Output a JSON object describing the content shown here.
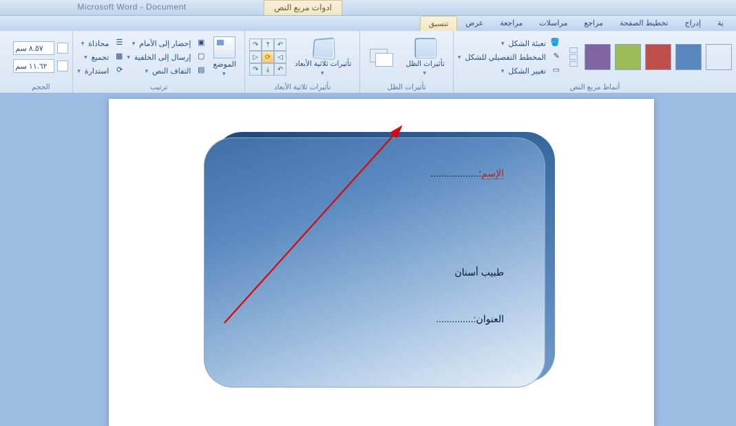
{
  "title": {
    "contextual_tab": "ادوات مربع النص",
    "app": "Microsoft Word - Document"
  },
  "tabs": {
    "t0": "ية",
    "t1": "إدراج",
    "t2": "تخطيط الصفحة",
    "t3": "مراجع",
    "t4": "مراسلات",
    "t5": "مراجعة",
    "t6": "عرض",
    "t7": "تنسيق"
  },
  "styles_group": {
    "label": "أنماط مربع النص",
    "fill": "تعبئة الشكل",
    "outline": "المخطط التفصيلي للشكل",
    "change": "تغيير الشكل",
    "colors": {
      "c0": "#000",
      "c1": "#5b87bf",
      "c2": "#be4f4a",
      "c3": "#9cbb59",
      "c4": "#8064a2"
    }
  },
  "shadow": {
    "group": "تأثيرات الظل",
    "btn": "تأثيرات الظل"
  },
  "three_d": {
    "group": "تأثيرات ثلاثية الأبعاد",
    "btn": "تأثيرات ثلاثية الأبعاد"
  },
  "arrange": {
    "group": "ترتيب",
    "position": "الموضع",
    "front": "إحضار إلى الأمام",
    "back": "إرسال إلى الخلفية",
    "wrap": "التفاف النص",
    "align": "محاذاة",
    "group_btn": "تجميع",
    "rotate": "استدارة"
  },
  "size": {
    "group": "الحجم",
    "h": "٨.٥٧ سم",
    "w": "١١.٦٢ سم"
  },
  "doc": {
    "line1_label": "الإسم",
    "line1_dots": "..................",
    "line2": "طبيب أسنان",
    "line3_label": "العنوان:",
    "line3_dots": ".............."
  }
}
